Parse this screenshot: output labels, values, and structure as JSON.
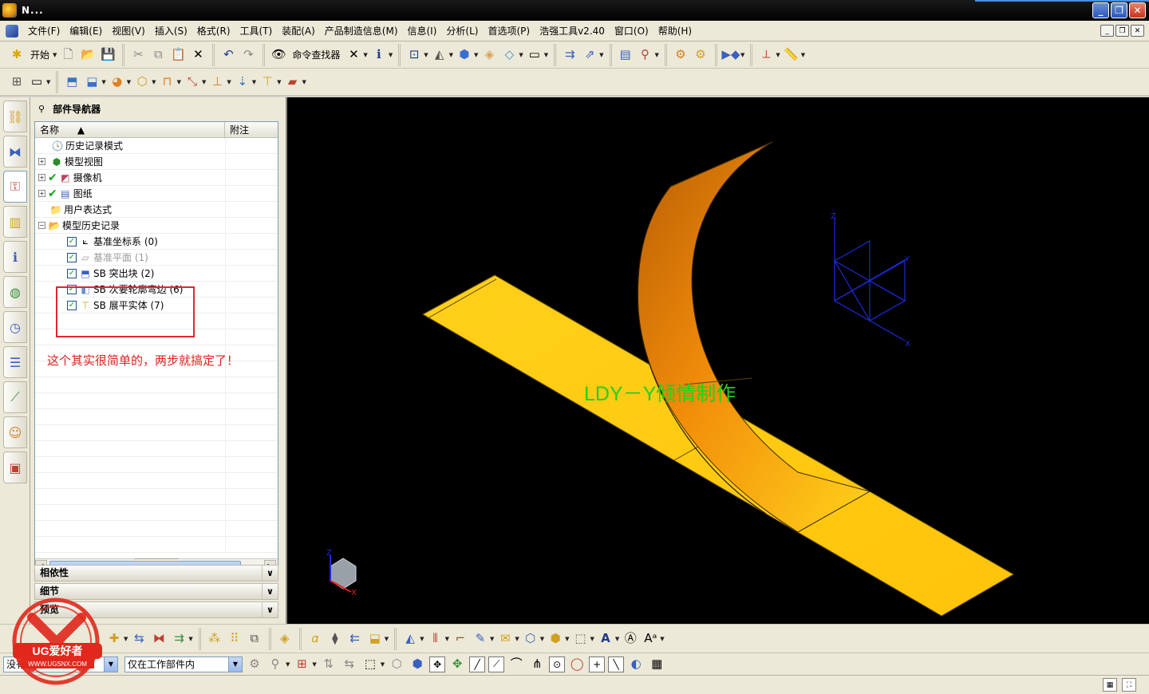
{
  "window": {
    "title": "N..."
  },
  "menu": {
    "items": [
      "文件(F)",
      "编辑(E)",
      "视图(V)",
      "插入(S)",
      "格式(R)",
      "工具(T)",
      "装配(A)",
      "产品制造信息(M)",
      "信息(I)",
      "分析(L)",
      "首选项(P)",
      "浩强工具v2.40",
      "窗口(O)",
      "帮助(H)"
    ]
  },
  "toolbar": {
    "start_label": "开始",
    "command_finder_label": "命令查找器"
  },
  "navigator": {
    "title": "部件导航器",
    "columns": [
      "名称",
      "附注"
    ],
    "nodes": [
      {
        "label": "历史记录模式"
      },
      {
        "label": "模型视图"
      },
      {
        "label": "摄像机"
      },
      {
        "label": "图纸"
      },
      {
        "label": "用户表达式"
      },
      {
        "label": "模型历史记录"
      },
      {
        "label": "基准坐标系 (0)"
      },
      {
        "label": "基准平面 (1)"
      },
      {
        "label": "SB 突出块 (2)"
      },
      {
        "label": "SB 次要轮廓弯边 (6)"
      },
      {
        "label": "SB 展平实体 (7)"
      }
    ],
    "note": "这个其实很简单的，两步就搞定了！",
    "sections": [
      "相依性",
      "细节",
      "预览"
    ]
  },
  "graphics": {
    "watermark": "LDY－Y倾情制作",
    "axes": {
      "z": "Z",
      "y": "Y",
      "x": "X"
    },
    "triad": {
      "z": "Z",
      "x": "X"
    }
  },
  "selection": {
    "filter_value": "没有选择过滤器",
    "scope_value": "仅在工作部件内"
  },
  "logo": {
    "brand": "UG爱好者",
    "url": "WWW.UGSNX.COM"
  },
  "colors": {
    "accent": "#f5c518",
    "highlight": "#e0262f",
    "background_3d": "#000000",
    "axis": "#1a2bd8"
  }
}
